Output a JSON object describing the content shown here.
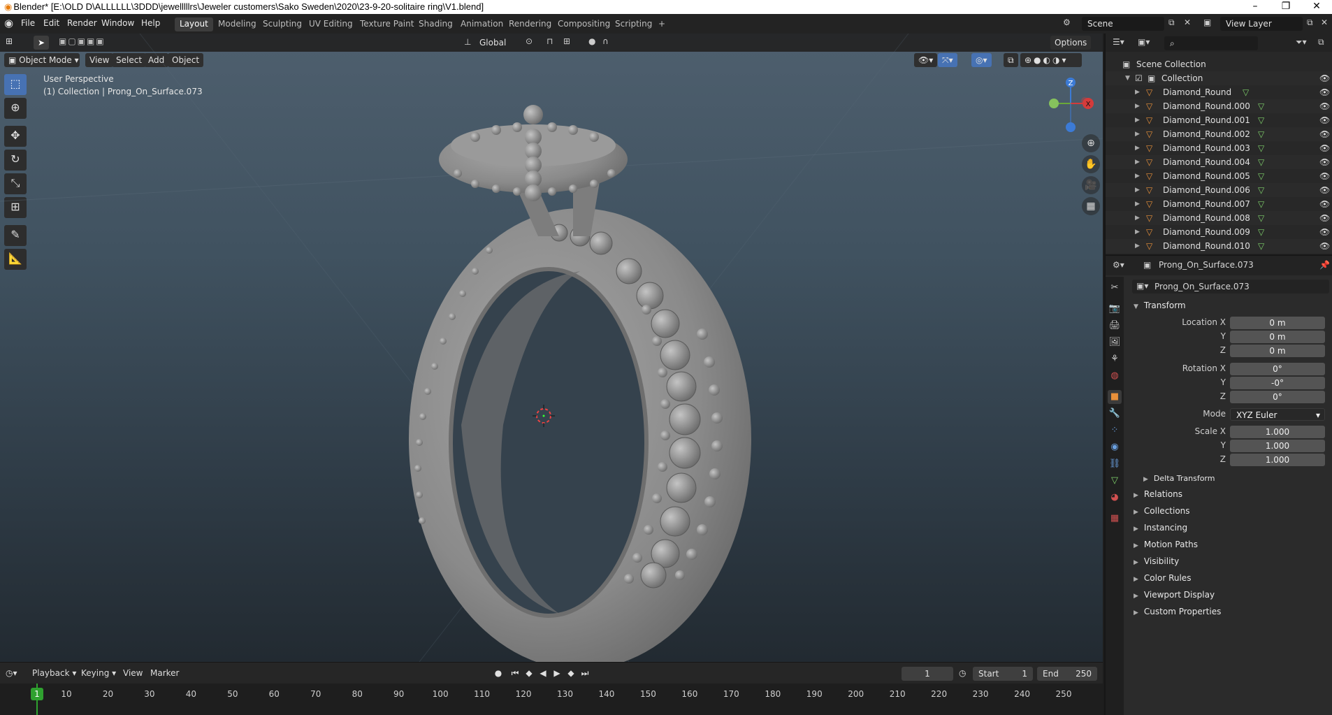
{
  "window": {
    "title": "Blender* [E:\\OLD D\\ALLLLLL\\3DDD\\jewelllllrs\\Jeweler customers\\Sako Sweden\\2020\\23-9-20-solitaire ring\\V1.blend]",
    "minimize": "–",
    "restore": "❐",
    "close": "✕"
  },
  "menu": [
    "File",
    "Edit",
    "Render",
    "Window",
    "Help"
  ],
  "workspaces": [
    "Layout",
    "Modeling",
    "Sculpting",
    "UV Editing",
    "Texture Paint",
    "Shading",
    "Animation",
    "Rendering",
    "Compositing",
    "Scripting"
  ],
  "workspace_add": "+",
  "scene": {
    "name": "Scene",
    "view_layer": "View Layer"
  },
  "viewport": {
    "mode": "Object Mode",
    "header_menus": [
      "View",
      "Select",
      "Add",
      "Object"
    ],
    "orientation": "Global",
    "options": "Options",
    "hud_line1": "User Perspective",
    "hud_line2": "(1) Collection | Prong_On_Surface.073",
    "gizmo": {
      "x": "X",
      "y": "Y",
      "z": "Z"
    }
  },
  "timeline": {
    "menus": [
      "Playback",
      "Keying",
      "View",
      "Marker"
    ],
    "current_frame": "1",
    "start_label": "Start",
    "start": "1",
    "end_label": "End",
    "end": "250",
    "ticks": [
      "1",
      "10",
      "20",
      "30",
      "40",
      "50",
      "60",
      "70",
      "80",
      "90",
      "100",
      "110",
      "120",
      "130",
      "140",
      "150",
      "160",
      "170",
      "180",
      "190",
      "200",
      "210",
      "220",
      "230",
      "240",
      "250"
    ]
  },
  "outliner": {
    "root": "Scene Collection",
    "collection": "Collection",
    "items": [
      "Diamond_Round",
      "Diamond_Round.000",
      "Diamond_Round.001",
      "Diamond_Round.002",
      "Diamond_Round.003",
      "Diamond_Round.004",
      "Diamond_Round.005",
      "Diamond_Round.006",
      "Diamond_Round.007",
      "Diamond_Round.008",
      "Diamond_Round.009",
      "Diamond_Round.010"
    ]
  },
  "properties": {
    "object_name": "Prong_On_Surface.073",
    "data_name": "Prong_On_Surface.073",
    "transform_header": "Transform",
    "location": {
      "label": "Location X",
      "x": "0 m",
      "y": "0 m",
      "z": "0 m"
    },
    "rotation": {
      "label": "Rotation X",
      "x": "0°",
      "y": "-0°",
      "z": "0°"
    },
    "mode_label": "Mode",
    "mode_value": "XYZ Euler",
    "scale": {
      "label": "Scale X",
      "x": "1.000",
      "y": "1.000",
      "z": "1.000"
    },
    "axis_y": "Y",
    "axis_z": "Z",
    "delta_transform": "Delta Transform",
    "panels": [
      "Relations",
      "Collections",
      "Instancing",
      "Motion Paths",
      "Visibility",
      "Color Rules",
      "Viewport Display",
      "Custom Properties"
    ]
  },
  "colors": {
    "accent_blue": "#4772b3",
    "object_orange": "#e8903a",
    "mesh_green": "#7fd16b",
    "frame_green": "#2fa12f"
  }
}
